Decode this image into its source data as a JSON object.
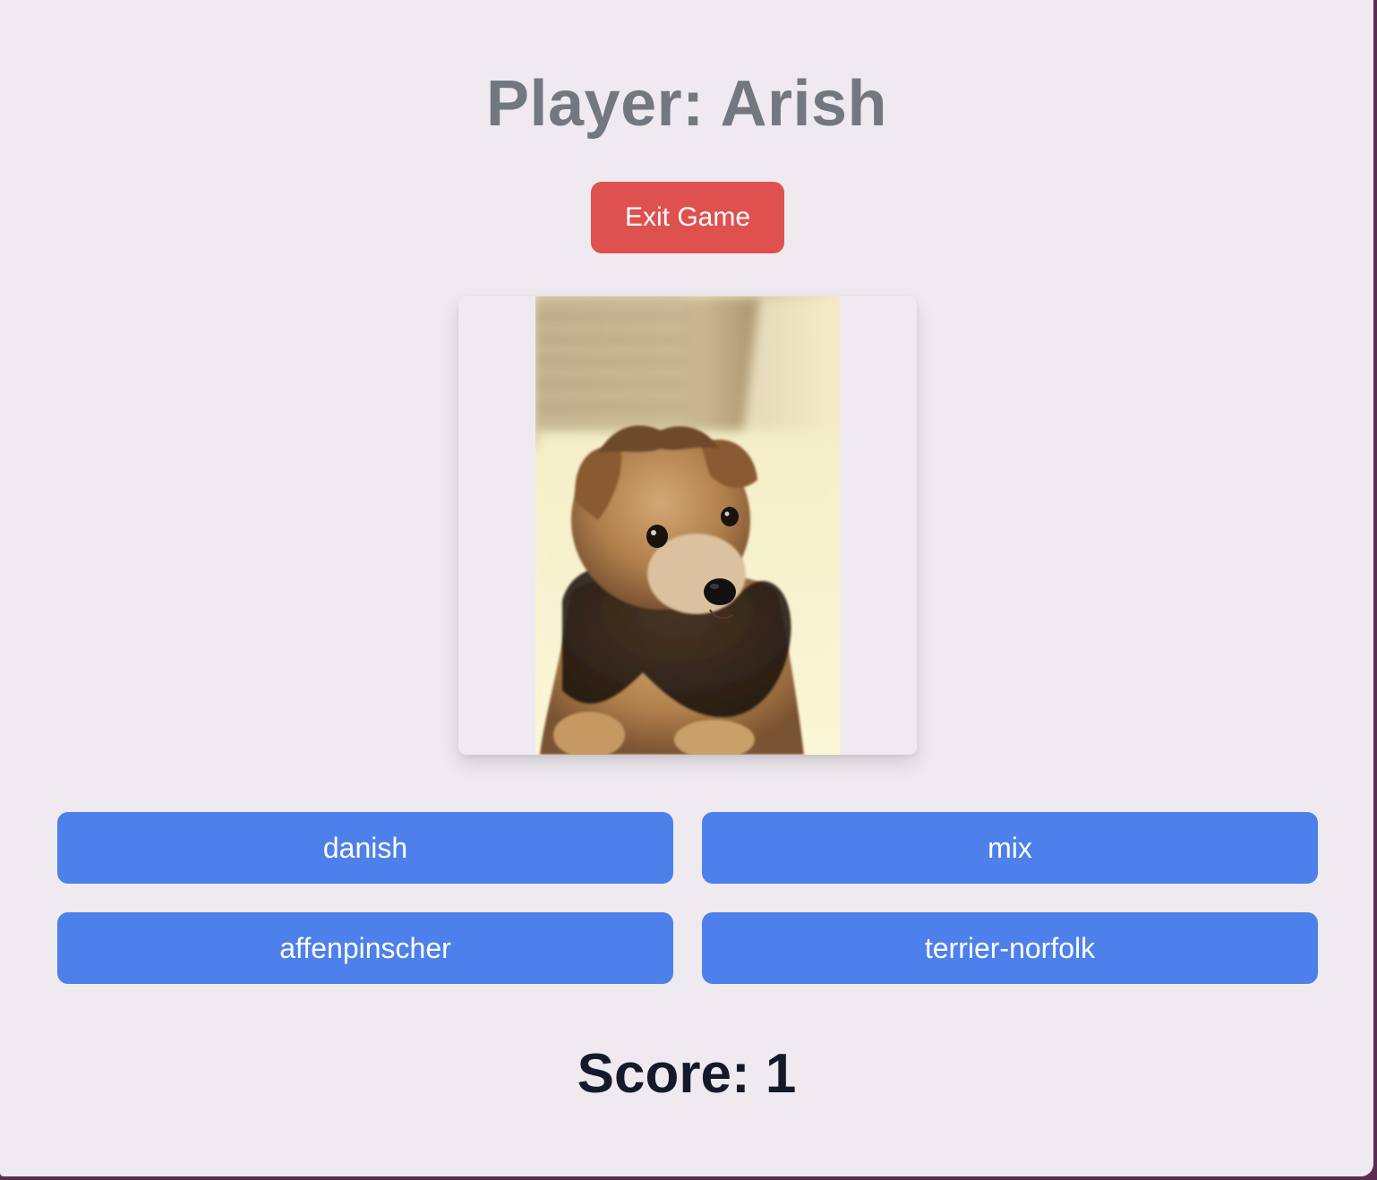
{
  "header": {
    "player_title": "Player: Arish"
  },
  "controls": {
    "exit_label": "Exit Game"
  },
  "question": {
    "image_subject": "dog photo (small scruffy tan and black terrier sitting)"
  },
  "answers": [
    {
      "label": "danish"
    },
    {
      "label": "mix"
    },
    {
      "label": "affenpinscher"
    },
    {
      "label": "terrier-norfolk"
    }
  ],
  "footer": {
    "score_text": "Score: 1"
  },
  "colors": {
    "background": "#efeaf0",
    "title_text": "#737780",
    "exit_button": "#de514f",
    "answer_button": "#4d80ea",
    "score_text": "#141a2a"
  }
}
